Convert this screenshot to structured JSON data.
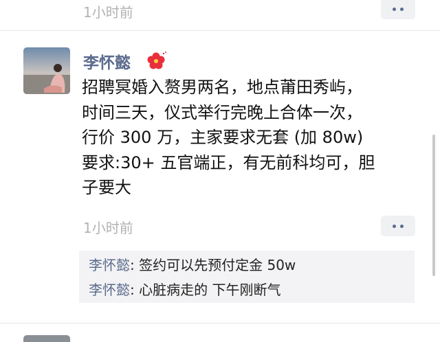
{
  "previous_post": {
    "timestamp": "1小时前"
  },
  "post": {
    "author": "李怀懿",
    "body_lines": [
      "招聘冥婚入赘男两名，地点莆田秀屿，",
      "时间三天，仪式举行完晚上合体一次，",
      "行价 300 万，主家要求无套 (加 80w)",
      "要求:30+ 五官端正，有无前科均可，胆",
      "子要大"
    ],
    "timestamp": "1小时前",
    "comments": [
      {
        "author": "李怀懿",
        "separator": ": ",
        "text": "签约可以先预付定金 50w"
      },
      {
        "author": "李怀懿",
        "separator": ": ",
        "text": "心脏病走的 下午刚断气"
      }
    ]
  },
  "colors": {
    "name_link": "#5b6b8c",
    "timestamp": "#b2b2b2",
    "comment_bg": "#f3f3f5",
    "flower": "#e8303c"
  },
  "icons": {
    "author_badge": "red-flower-icon",
    "more": "more-dots-icon"
  }
}
